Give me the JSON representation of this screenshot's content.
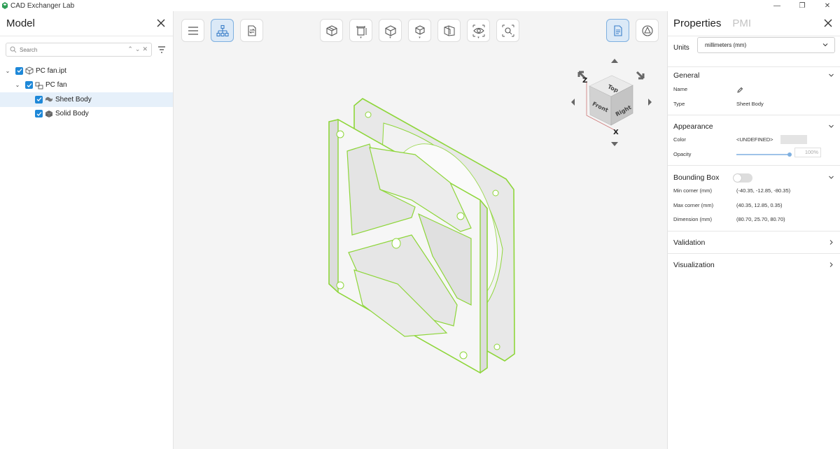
{
  "window": {
    "title": "CAD Exchanger Lab"
  },
  "left_panel": {
    "title": "Model",
    "search_placeholder": "Search",
    "tree": [
      {
        "label": "PC fan.ipt",
        "level": 0,
        "expanded": true,
        "checked": true,
        "icon": "part-icon",
        "selected": false
      },
      {
        "label": "PC fan",
        "level": 1,
        "expanded": true,
        "checked": true,
        "icon": "assembly-icon",
        "selected": false
      },
      {
        "label": "Sheet Body",
        "level": 2,
        "checked": true,
        "icon": "sheet-body-icon",
        "selected": true
      },
      {
        "label": "Solid Body",
        "level": 2,
        "checked": true,
        "icon": "solid-body-icon",
        "selected": false
      }
    ]
  },
  "toolbar": {
    "left": [
      "menu-icon",
      "structure-tree-icon",
      "swap-icon"
    ],
    "center": [
      "section-view-icon",
      "measure-icon",
      "display-mode-icon",
      "explode-icon",
      "projection-icon",
      "visibility-icon",
      "fit-view-icon"
    ],
    "right": [
      "properties-icon",
      "pmi-icon"
    ]
  },
  "view_cube": {
    "top": "Top",
    "front": "Front",
    "right": "Right",
    "axis_x": "X",
    "axis_z": "Z"
  },
  "properties": {
    "tab_properties": "Properties",
    "tab_pmi": "PMI",
    "units_label": "Units",
    "units_value": "millimeters (mm)",
    "general": {
      "title": "General",
      "name_label": "Name",
      "type_label": "Type",
      "type_value": "Sheet Body"
    },
    "appearance": {
      "title": "Appearance",
      "color_label": "Color",
      "color_value": "<UNDEFINED>",
      "opacity_label": "Opacity",
      "opacity_value": "100%",
      "opacity_fraction": 1.0
    },
    "bounding_box": {
      "title": "Bounding Box",
      "min_label": "Min corner (mm)",
      "min_value": "(-40.35, -12.85, -80.35)",
      "max_label": "Max corner (mm)",
      "max_value": "(40.35, 12.85, 0.35)",
      "dim_label": "Dimension (mm)",
      "dim_value": "(80.70, 25.70, 80.70)"
    },
    "validation": {
      "title": "Validation"
    },
    "visualization": {
      "title": "Visualization"
    }
  },
  "colors": {
    "accent": "#1e88d8",
    "highlight": "#7ed321",
    "selection_bg": "#e6f0fa"
  }
}
